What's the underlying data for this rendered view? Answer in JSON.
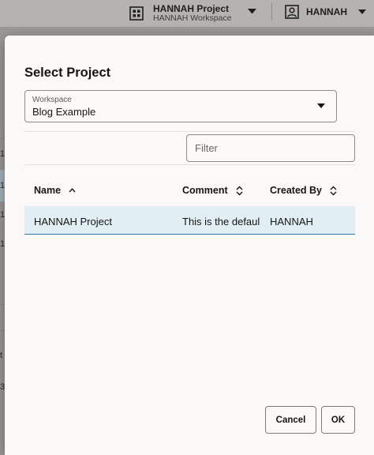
{
  "topbar": {
    "project_name": "HANNAH Project",
    "workspace_name": "HANNAH Workspace",
    "user_name": "HANNAH"
  },
  "background": {
    "digits": [
      "1",
      "1",
      "1",
      "1",
      "t",
      "3"
    ]
  },
  "dialog": {
    "title": "Select Project",
    "workspace": {
      "label": "Workspace",
      "value": "Blog Example"
    },
    "filter": {
      "placeholder": "Filter",
      "value": ""
    },
    "table": {
      "columns": [
        "Name",
        "Comment",
        "Created By"
      ],
      "rows": [
        {
          "name": "HANNAH Project",
          "comment": "This is the default project",
          "created_by": "HANNAH"
        }
      ]
    },
    "buttons": {
      "cancel": "Cancel",
      "ok": "OK"
    }
  },
  "colors": {
    "selected_row": "#e1eff4",
    "selected_row_border": "#2e7aa6",
    "modal_bg": "#fbf9f8"
  }
}
